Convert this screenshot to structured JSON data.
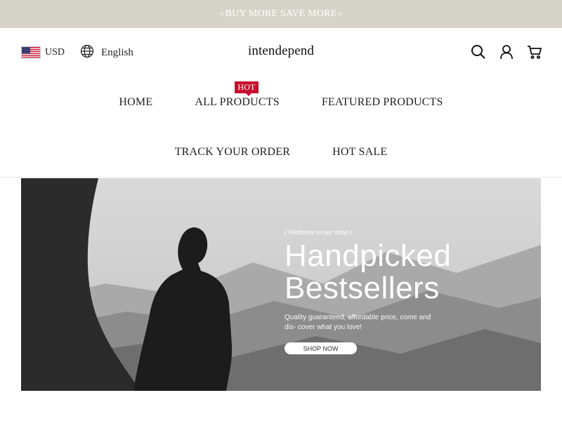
{
  "announcement": {
    "text": "BUY MORE SAVE MORE",
    "spark_left": "✧",
    "spark_right": "✧"
  },
  "header": {
    "currency": "USD",
    "language": "English",
    "logo": "intendepend",
    "icons": [
      "search-icon",
      "account-icon",
      "cart-icon"
    ]
  },
  "nav": {
    "row1": [
      {
        "label": "HOME"
      },
      {
        "label": "ALL PRODUCTS",
        "badge": "HOT"
      },
      {
        "label": "FEATURED PRODUCTS"
      }
    ],
    "row2": [
      {
        "label": "TRACK YOUR ORDER"
      },
      {
        "label": "HOT SALE"
      }
    ]
  },
  "hero": {
    "welcome": "( Welcome to our shop )",
    "title_line1": "Handpicked",
    "title_line2": "Bestsellers",
    "subtitle": "Quality guaranteed, affordable price, come and dis- cover what you love!",
    "button": "SHOP NOW"
  },
  "colors": {
    "announcement_bg": "#d6d3c8",
    "badge": "#c8102e"
  }
}
